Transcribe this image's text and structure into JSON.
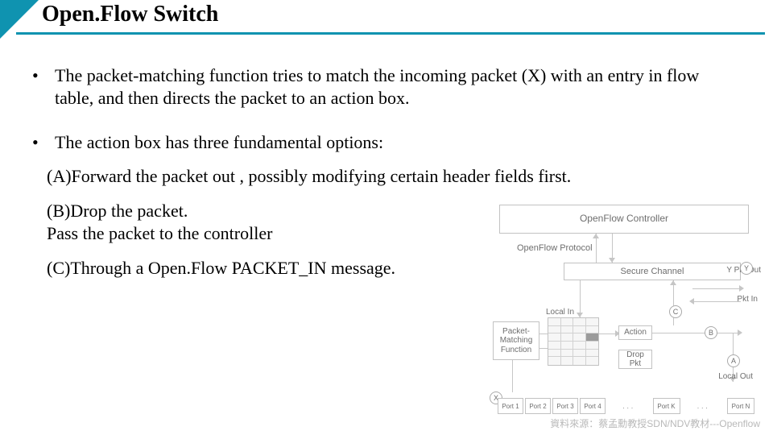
{
  "title": "Open.Flow Switch",
  "bullets": [
    "The packet-matching function tries to match the incoming packet (X) with an entry in flow table, and then directs the packet to an action box.",
    "The action box has three fundamental options:"
  ],
  "options": {
    "a": "(A)Forward the packet out , possibly modifying certain header fields first.",
    "b_line1": "(B)Drop the packet.",
    "b_line2": "Pass the packet to the controller",
    "c": "(C)Through a Open.Flow PACKET_IN message."
  },
  "diagram": {
    "controller": "OpenFlow Controller",
    "protocol_label": "OpenFlow Protocol",
    "secure_channel": "Secure Channel",
    "pkt_out": "Pkt Out",
    "pkt_in": "Pkt In",
    "local_in": "Local In",
    "local_out": "Local Out",
    "pmf": "Packet-\nMatching\nFunction",
    "action": "Action",
    "drop": "Drop\nPkt",
    "circles": {
      "X": "X",
      "Y": "Y",
      "A": "A",
      "B": "B",
      "C": "C"
    },
    "ports": [
      "Port 1",
      "Port 2",
      "Port 3",
      "Port 4",
      "Port K",
      "Port N"
    ],
    "port_ellipsis": "..."
  },
  "footer": "資料來源：蔡孟勳教授SDN/NDV教材---Openflow"
}
